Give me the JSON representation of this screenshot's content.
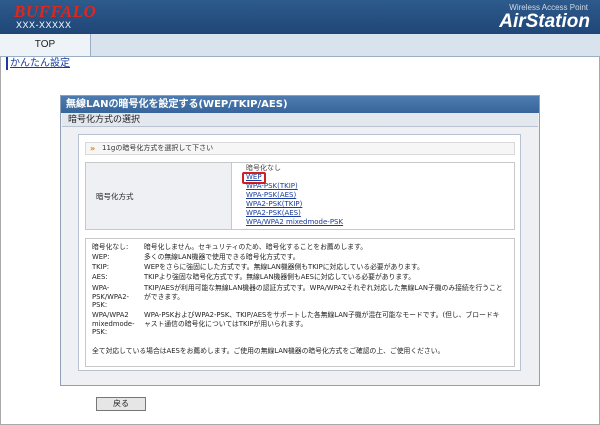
{
  "header": {
    "logo": "BUFFALO",
    "model": "XXX-XXXXX",
    "tagline": "Wireless Access Point",
    "product": "AirStation"
  },
  "nav": {
    "top_tab": "TOP",
    "sub_link": "かんたん設定"
  },
  "panel": {
    "title": "無線LANの暗号化を設定する(WEP/TKIP/AES)",
    "section": "暗号化方式の選択",
    "instruction": "11gの暗号化方式を選択して下さい",
    "field_label": "暗号化方式",
    "options": [
      "暗号化なし",
      "WEP",
      "WPA-PSK(TKIP)",
      "WPA-PSK(AES)",
      "WPA2-PSK(TKIP)",
      "WPA2-PSK(AES)",
      "WPA/WPA2 mixedmode-PSK"
    ],
    "highlighted_option": "WEP",
    "descriptions": [
      {
        "term": "暗号化なし:",
        "text": "暗号化しません。セキュリティのため、暗号化することをお薦めします。"
      },
      {
        "term": "WEP:",
        "text": "多くの無線LAN機器で使用できる暗号化方式です。"
      },
      {
        "term": "TKIP:",
        "text": "WEPをさらに強固にした方式です。無線LAN機器側もTKIPに対応している必要があります。"
      },
      {
        "term": "AES:",
        "text": "TKIPより強固な暗号化方式です。無線LAN機器側もAESに対応している必要があります。"
      },
      {
        "term": "WPA-PSK/WPA2-PSK:",
        "text": "TKIP/AESが利用可能な無線LAN機器の認証方式です。WPA/WPA2それぞれ対応した無線LAN子機のみ接続を行うことができます。"
      },
      {
        "term": "WPA/WPA2 mixedmode-PSK:",
        "text": "WPA-PSKおよびWPA2-PSK、TKIP/AESをサポートした各無線LAN子機が混在可能なモードです。(但し、ブロードキャスト通信の暗号化についてはTKIPが用いられます。"
      }
    ],
    "note": "全て対応している場合はAESをお薦めします。ご使用の無線LAN機器の暗号化方式をご確認の上、ご使用ください。"
  },
  "footer": {
    "back_button": "戻る"
  },
  "colors": {
    "header_bg": "#1f4677",
    "logo": "#e1261c",
    "link": "#1a3c9c",
    "highlight": "#d02020"
  }
}
